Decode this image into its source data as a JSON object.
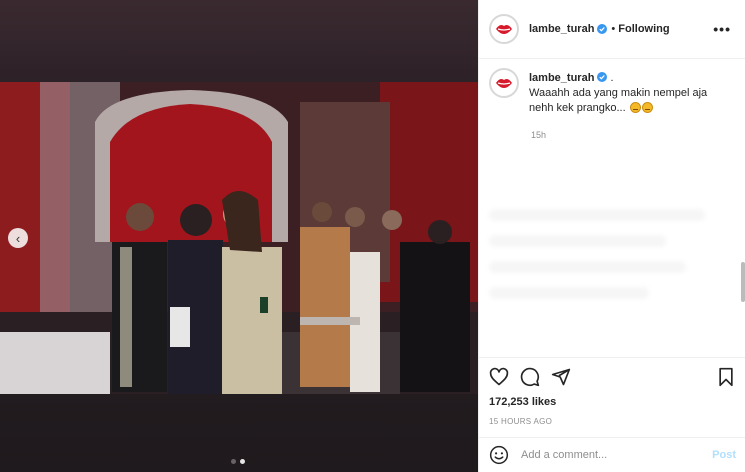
{
  "post": {
    "username": "lambe_turah",
    "follow_separator": "•",
    "follow_status": "Following",
    "more_label": "•••"
  },
  "caption": {
    "username": "lambe_turah",
    "trailing": " .",
    "text": "Waaahh ada yang makin nempel aja nehh kek prangko...",
    "time": "15h"
  },
  "engagement": {
    "likes": "172,253 likes",
    "posted_ago": "15 HOURS AGO"
  },
  "comment": {
    "placeholder": "Add a comment...",
    "post_label": "Post"
  },
  "carousel": {
    "prev_label": "‹",
    "slides": 2,
    "active_slide": 2
  },
  "icons": {
    "like": "heart-icon",
    "comment": "comment-icon",
    "share": "share-icon",
    "save": "bookmark-icon",
    "emoji": "smiley-icon",
    "verified": "verified-badge-icon"
  },
  "colors": {
    "accent_link": "#b2dffc",
    "verified": "#3897f0",
    "brand_lips": "#d6192b"
  }
}
